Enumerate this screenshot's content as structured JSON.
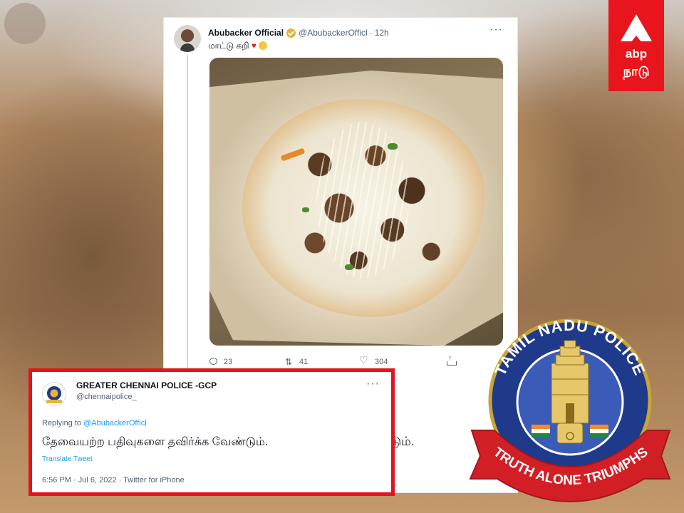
{
  "tweet": {
    "author": "Abubacker Official",
    "handle": "@AbubackerOfficl",
    "dot": "·",
    "time": "12h",
    "text": "மாட்டு கறி",
    "more": "···",
    "stats": {
      "replies": "23",
      "retweets": "41",
      "likes": "304"
    }
  },
  "behind_text": "டும்.",
  "reply": {
    "author": "GREATER CHENNAI POLICE -GCP",
    "handle": "@chennaipolice_",
    "more": "···",
    "replying_prefix": "Replying to ",
    "replying_mention": "@AbubackerOfficl",
    "text": "தேவையற்ற பதிவுகளை தவிர்க்க வேண்டும்.",
    "translate": "Translate Tweet",
    "meta": "6:56 PM · Jul 6, 2022 · Twitter for iPhone"
  },
  "logo": {
    "brand": "abp",
    "sub": "நாடு"
  },
  "emblem": {
    "top_text": "TAMIL NADU POLICE",
    "ribbon_text": "TRUTH ALONE TRIUMPHS"
  },
  "colors": {
    "accent_red": "#e2141b",
    "link_blue": "#1d9bf0",
    "police_blue": "#1f3a8a"
  },
  "icons": {
    "reply": "reply-icon",
    "retweet": "retweet-icon",
    "like": "heart-icon",
    "share": "share-icon",
    "verified": "verified-badge-icon",
    "more": "more-icon"
  }
}
